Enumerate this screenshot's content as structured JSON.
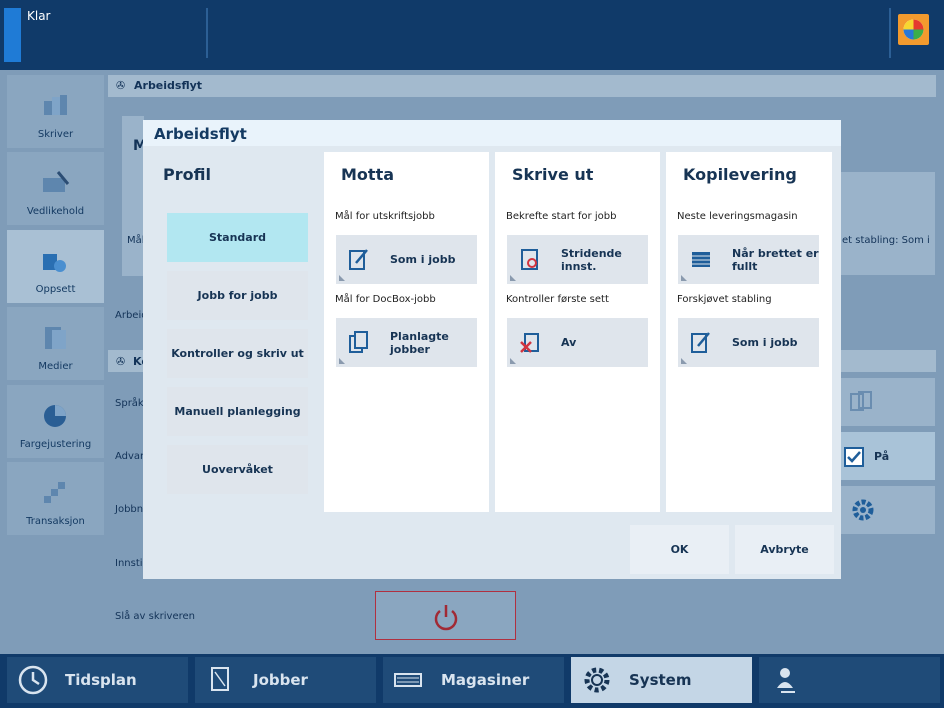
{
  "topbar": {
    "status": "Klar",
    "app_icon": "color-wheel-icon"
  },
  "sidebar": [
    {
      "label": "Skriver",
      "icon": "printer-icon"
    },
    {
      "label": "Vedlikehold",
      "icon": "maintenance-icon"
    },
    {
      "label": "Oppsett",
      "icon": "setup-icon"
    },
    {
      "label": "Medier",
      "icon": "media-icon"
    },
    {
      "label": "Fargejustering",
      "icon": "color-adjust-icon"
    },
    {
      "label": "Transaksjon",
      "icon": "transaction-icon"
    }
  ],
  "background": {
    "section_title": "Arbeidsflyt",
    "partial_letter_1": "M",
    "partial_text_1": "Mål",
    "row_arbeid": "Arbeid",
    "section_title_2": "Ko",
    "row_sprak": "Språk",
    "row_advarsel": "Advars",
    "row_jobb": "Jobbna",
    "row_innst": "Innstill",
    "row_power": "Slå av skriveren",
    "right_text": "et stabling: Som i",
    "toggle_label": "På"
  },
  "dialog": {
    "title": "Arbeidsflyt",
    "profile": {
      "heading": "Profil",
      "items": [
        "Standard",
        "Jobb for jobb",
        "Kontroller og skriv ut",
        "Manuell planlegging",
        "Uovervåket"
      ]
    },
    "motta": {
      "heading": "Motta",
      "label1": "Mål for utskriftsjobb",
      "value1": "Som i jobb",
      "label2": "Mål for DocBox-jobb",
      "value2": "Planlagte jobber"
    },
    "skrive_ut": {
      "heading": "Skrive ut",
      "label1": "Bekrefte start for jobb",
      "value1": "Stridende innst.",
      "label2": "Kontroller første sett",
      "value2": "Av"
    },
    "kopilevering": {
      "heading": "Kopilevering",
      "label1": "Neste leveringsmagasin",
      "value1": "Når brettet er fullt",
      "label2": "Forskjøvet stabling",
      "value2": "Som i jobb"
    },
    "ok": "OK",
    "cancel": "Avbryte"
  },
  "bottom_tabs": [
    {
      "label": "Tidsplan",
      "icon": "clock-icon"
    },
    {
      "label": "Jobber",
      "icon": "jobs-icon"
    },
    {
      "label": "Magasiner",
      "icon": "tray-icon"
    },
    {
      "label": "System",
      "icon": "gear-icon"
    },
    {
      "label": "",
      "icon": "user-key-icon"
    }
  ]
}
